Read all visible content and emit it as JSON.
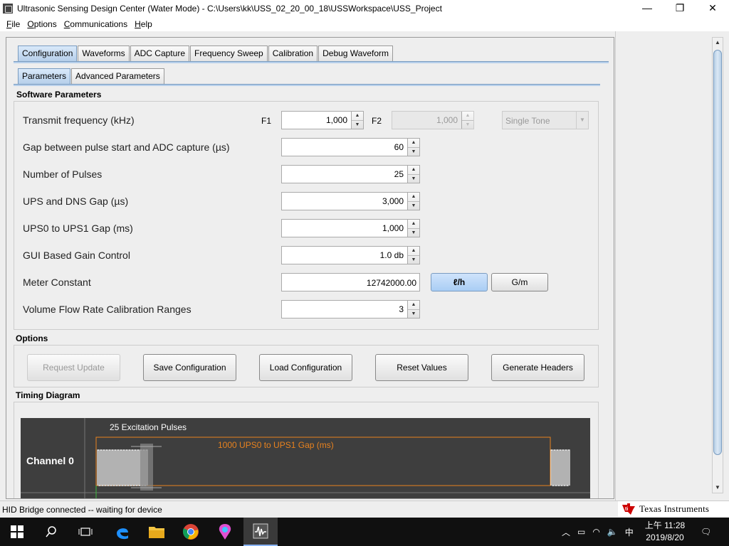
{
  "window": {
    "title": "Ultrasonic Sensing Design Center (Water Mode) - C:\\Users\\kk\\USS_02_20_00_18\\USSWorkspace\\USS_Project",
    "controls": {
      "minimize": "—",
      "maximize": "❐",
      "close": "✕"
    }
  },
  "menu": [
    {
      "key": "F",
      "rest": "ile"
    },
    {
      "key": "O",
      "rest": "ptions"
    },
    {
      "key": "C",
      "rest": "ommunications"
    },
    {
      "key": "H",
      "rest": "elp"
    }
  ],
  "tabs": [
    "Configuration",
    "Waveforms",
    "ADC Capture",
    "Frequency Sweep",
    "Calibration",
    "Debug Waveform"
  ],
  "subtabs": [
    "Parameters",
    "Advanced Parameters"
  ],
  "software_parameters": {
    "heading": "Software Parameters",
    "transmit_frequency": {
      "label": "Transmit frequency (kHz)",
      "f1_label": "F1",
      "f1_value": "1,000",
      "f2_label": "F2",
      "f2_value": "1,000",
      "mode": "Single Tone"
    },
    "gap_pulse_adc": {
      "label": "Gap between pulse start and ADC capture (µs)",
      "value": "60"
    },
    "num_pulses": {
      "label": "Number of Pulses",
      "value": "25"
    },
    "ups_dns_gap": {
      "label": "UPS and DNS Gap (µs)",
      "value": "3,000"
    },
    "ups0_ups1_gap": {
      "label": "UPS0 to UPS1 Gap (ms)",
      "value": "1,000"
    },
    "gain_control": {
      "label": "GUI Based Gain Control",
      "value": "1.0 db"
    },
    "meter_constant": {
      "label": "Meter Constant",
      "value": "12742000.00",
      "unit_lh": "ℓ/h",
      "unit_gm": "G/m"
    },
    "volume_flow_ranges": {
      "label": "Volume Flow Rate Calibration Ranges",
      "value": "3"
    }
  },
  "options": {
    "heading": "Options",
    "buttons": [
      "Request Update",
      "Save Configuration",
      "Load Configuration",
      "Reset Values",
      "Generate Headers"
    ]
  },
  "timing": {
    "heading": "Timing Diagram",
    "channel_label": "Channel 0",
    "pulses_label": "25 Excitation Pulses",
    "gap_label": "1000 UPS0 to UPS1 Gap (ms)"
  },
  "status": {
    "text": "HID Bridge connected -- waiting for device",
    "brand": "Texas Instruments"
  },
  "taskbar": {
    "time": "上午 11:28",
    "date": "2019/8/20",
    "ime": "中"
  }
}
